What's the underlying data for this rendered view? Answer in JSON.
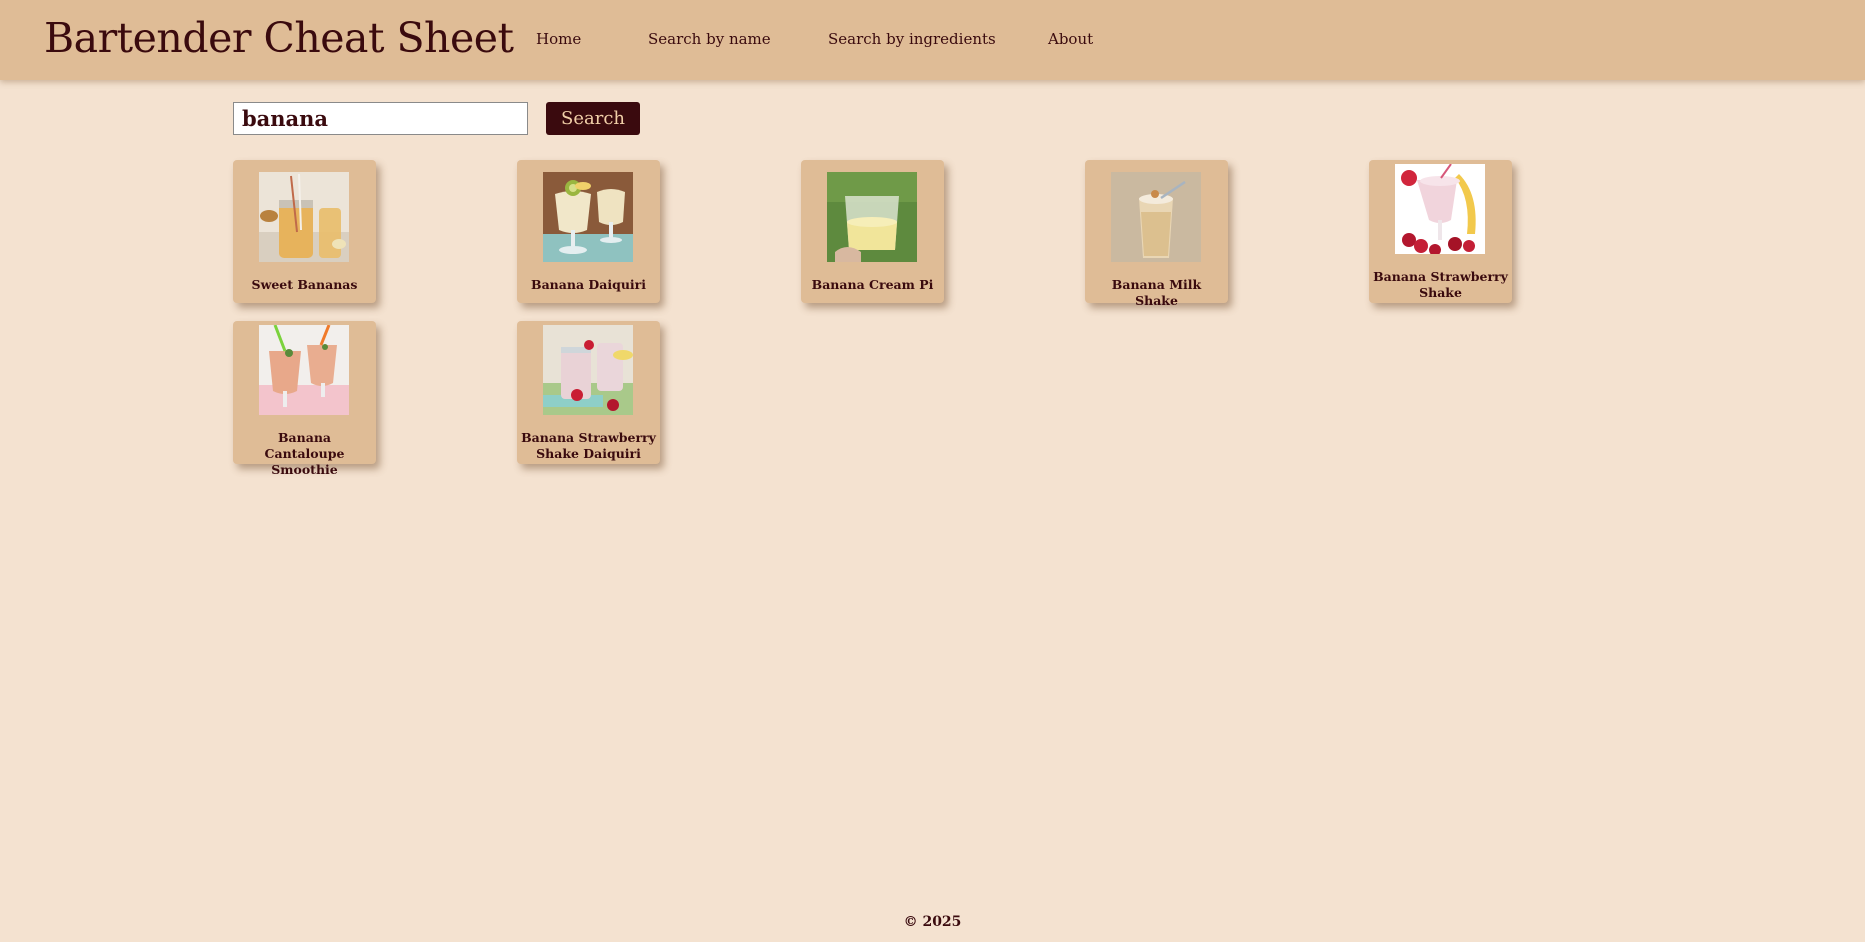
{
  "header": {
    "title": "Bartender Cheat Sheet",
    "nav": [
      "Home",
      "Search by name",
      "Search by ingredients",
      "About"
    ]
  },
  "search": {
    "value": "banana",
    "button_label": "Search"
  },
  "results": [
    {
      "name": "Sweet Bananas",
      "image_icon": "drink-photo"
    },
    {
      "name": "Banana Daiquiri",
      "image_icon": "drink-photo"
    },
    {
      "name": "Banana Cream Pi",
      "image_icon": "drink-photo"
    },
    {
      "name": "Banana Milk Shake",
      "image_icon": "drink-photo"
    },
    {
      "name": "Banana Strawberry Shake",
      "image_icon": "drink-photo"
    },
    {
      "name": "Banana Cantaloupe Smoothie",
      "image_icon": "drink-photo"
    },
    {
      "name": "Banana Strawberry Shake Daiquiri",
      "image_icon": "drink-photo"
    }
  ],
  "footer": {
    "text": "© 2025"
  },
  "colors": {
    "page_background": "#f4e2d0",
    "header_background": "#dfbc96",
    "accent_dark": "#3a0a0e",
    "button_text": "#f1cfa8"
  }
}
